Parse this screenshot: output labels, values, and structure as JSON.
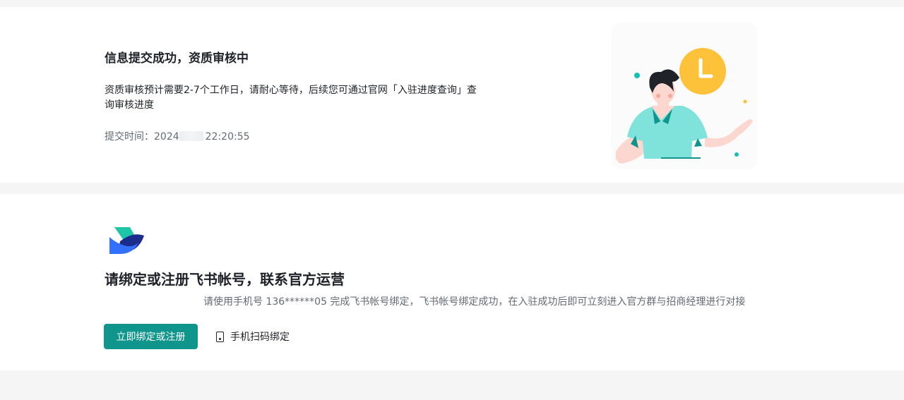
{
  "status_card": {
    "title": "信息提交成功，资质审核中",
    "description": "资质审核预计需要2-7个工作日，请耐心等待，后续您可通过官网「入驻进度查询」查询审核进度",
    "submit_time_label": "提交时间：",
    "submit_time_year": "2024",
    "submit_time_clock": "22:20:55",
    "illustration_icons": [
      "person-icon",
      "clock-icon"
    ]
  },
  "bind_card": {
    "logo": "feishu-logo",
    "title": "请绑定或注册飞书帐号，联系官方运营",
    "description": "请使用手机号 136******05 完成飞书帐号绑定，飞书帐号绑定成功，在入驻成功后即可立刻进入官方群与招商经理进行对接",
    "primary_button": "立即绑定或注册",
    "scan_link": "手机扫码绑定",
    "scan_icon": "phone-icon"
  },
  "colors": {
    "accent": "#0f958b",
    "page_background": "#f5f5f5",
    "card_background": "#ffffff",
    "clock_yellow": "#fec13a",
    "shirt_teal": "#7fe3dc"
  }
}
